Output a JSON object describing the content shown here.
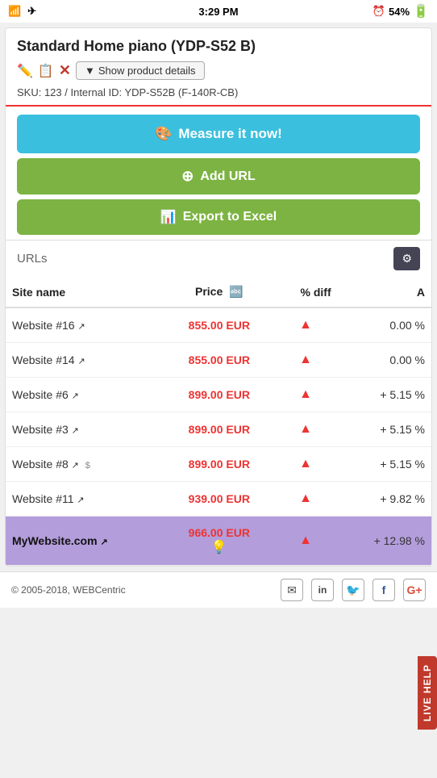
{
  "statusBar": {
    "time": "3:29 PM",
    "battery": "54%",
    "wifi": "wifi",
    "airplane": "airplane"
  },
  "product": {
    "title": "Standard Home piano (YDP-S52 B)",
    "showDetailsLabel": "Show product details",
    "skuLine": "SKU: 123 / Internal ID: YDP-S52B  (F-140R-CB)",
    "editIcon": "✏️",
    "copyIcon": "📋",
    "deleteIcon": "✕"
  },
  "buttons": {
    "measureLabel": "Measure it now!",
    "addUrlLabel": "Add URL",
    "exportLabel": "Export to Excel"
  },
  "urlsSection": {
    "label": "URLs"
  },
  "table": {
    "headers": {
      "siteName": "Site name",
      "price": "Price",
      "sort": "A↕Z",
      "diffPercent": "% diff",
      "colA": "A"
    },
    "rows": [
      {
        "site": "Website #16",
        "price": "855.00 EUR",
        "diff": "0.00 %",
        "isUp": true,
        "isMyWebsite": false
      },
      {
        "site": "Website #14",
        "price": "855.00 EUR",
        "diff": "0.00 %",
        "isUp": true,
        "isMyWebsite": false
      },
      {
        "site": "Website #6",
        "price": "899.00 EUR",
        "diff": "+ 5.15 %",
        "isUp": true,
        "isMyWebsite": false
      },
      {
        "site": "Website #3",
        "price": "899.00 EUR",
        "diff": "+ 5.15 %",
        "isUp": true,
        "isMyWebsite": false
      },
      {
        "site": "Website #8",
        "price": "899.00 EUR",
        "diff": "+ 5.15 %",
        "isUp": true,
        "isMyWebsite": false,
        "hasDollar": true
      },
      {
        "site": "Website #11",
        "price": "939.00 EUR",
        "diff": "+ 9.82 %",
        "isUp": true,
        "isMyWebsite": false
      },
      {
        "site": "MyWebsite.com",
        "price": "966.00 EUR",
        "diff": "+ 12.98 %",
        "isUp": true,
        "isMyWebsite": true
      }
    ]
  },
  "liveHelp": {
    "label": "LIVE HELP"
  },
  "footer": {
    "copyright": "© 2005-2018, WEBCentric"
  }
}
